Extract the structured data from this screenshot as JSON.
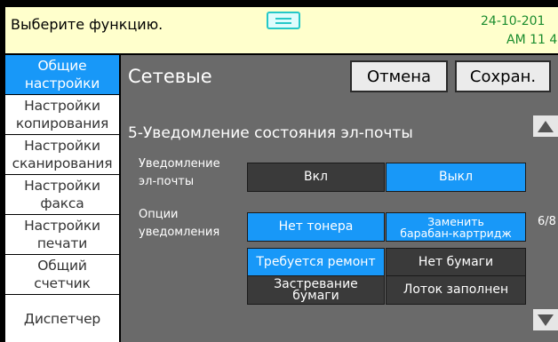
{
  "status": {
    "message": "Выберите функцию.",
    "date": "24-10-201",
    "time": "AM 11  4"
  },
  "sidebar": {
    "items": [
      {
        "label": "Общие\nнастройки",
        "active": true
      },
      {
        "label": "Настройки\nкопирования",
        "active": false
      },
      {
        "label": "Настройки\nсканирования",
        "active": false
      },
      {
        "label": "Настройки\nфакса",
        "active": false
      },
      {
        "label": "Настройки\nпечати",
        "active": false
      },
      {
        "label": "Общий\nсчетчик",
        "active": false
      },
      {
        "label": "Диспетчер",
        "active": false
      }
    ]
  },
  "header": {
    "title": "Сетевые",
    "cancel_label": "Отмена",
    "save_label": "Сохран."
  },
  "section": {
    "title": "5-Уведомление состояния эл-почты"
  },
  "email_notification": {
    "label": "Уведомление\nэл-почты",
    "on_label": "Вкл",
    "off_label": "Выкл",
    "selected": "Выкл"
  },
  "notify_options": {
    "label": "Опции\nуведомления",
    "items": [
      {
        "label": "Нет тонера",
        "selected": true
      },
      {
        "label": "Заменить\nбарабан-картридж",
        "selected": true
      },
      {
        "label": "Требуется ремонт",
        "selected": true
      },
      {
        "label": "Нет бумаги",
        "selected": false
      },
      {
        "label": "Застревание\nбумаги",
        "selected": false
      },
      {
        "label": "Лоток заполнен",
        "selected": false
      }
    ]
  },
  "pagination": {
    "indicator": "6/8"
  },
  "icons": {
    "up": "arrow-up-icon",
    "down": "arrow-down-icon",
    "status_handle": "status-handle-icon"
  },
  "colors": {
    "accent": "#1898f8",
    "status_bg": "#ffffcc",
    "status_time": "#1a8c2e",
    "panel_bg": "#6a6a6a",
    "option_bg": "#3a3a3a",
    "sidebar_bg": "#ffffff"
  }
}
